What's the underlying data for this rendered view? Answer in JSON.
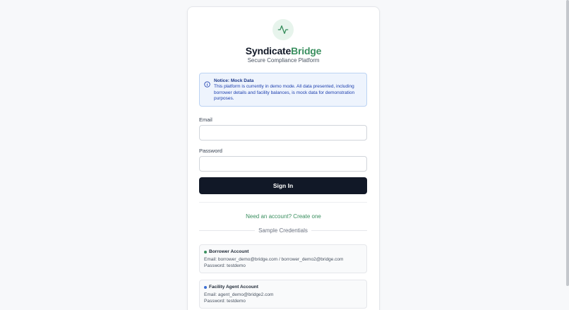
{
  "brand": {
    "name_part1": "Syndicate",
    "name_part2": "Bridge",
    "subtitle": "Secure Compliance Platform",
    "logo_icon": "activity-pulse-icon",
    "accent_color": "#3a8f5f"
  },
  "notice": {
    "icon": "info-icon",
    "title": "Notice: Mock Data",
    "lines": [
      "This platform is currently in demo mode. All data presented, including",
      "borrower details and facility balances, is mock data for demonstration",
      "purposes."
    ]
  },
  "form": {
    "email_label": "Email",
    "email_value": "",
    "password_label": "Password",
    "password_value": "",
    "submit_label": "Sign In"
  },
  "create_account_link": "Need an account? Create one",
  "sample_credentials": {
    "heading": "Sample Credentials",
    "accounts": [
      {
        "title": "Borrower Account",
        "dot_color": "#3a8f5f",
        "email_line": "Email: borrower_demo@bridge.com / borrower_demo2@bridge.com",
        "password_line": "Password: testdemo"
      },
      {
        "title": "Facility Agent Account",
        "dot_color": "#3b6fd4",
        "email_line": "Email: agent_demo@bridge2.com",
        "password_line": "Password: testdemo"
      }
    ]
  }
}
